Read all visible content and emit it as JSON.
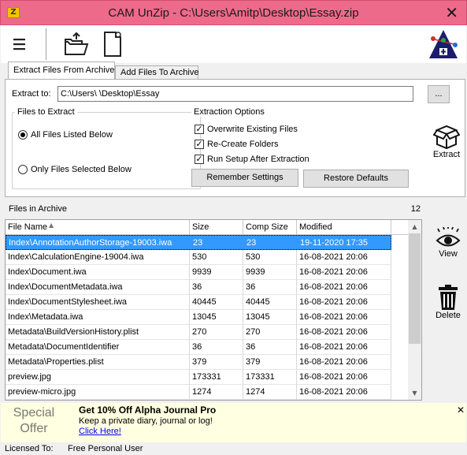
{
  "window": {
    "title": "CAM UnZip - C:\\Users\\Amitp\\Desktop\\Essay.zip",
    "close_glyph": "✕"
  },
  "toolbar": {
    "menu_icon": "hamburger-menu-icon",
    "extract_icon": "folder-extract-icon",
    "archive_icon": "document-archive-icon",
    "logo_icon": "cam-logo-icon"
  },
  "tabs": [
    {
      "label": "Extract Files From Archive",
      "active": true
    },
    {
      "label": "Add Files To Archive",
      "active": false
    }
  ],
  "extract": {
    "extract_to_label": "Extract to:",
    "extract_to_value": "C:\\Users\\      \\Desktop\\Essay",
    "browse_label": "...",
    "files_group_title": "Files to Extract",
    "radio_all": "All Files Listed Below",
    "radio_selected": "Only Files Selected Below",
    "options_group_title": "Extraction Options",
    "options": [
      {
        "label": "Overwrite Existing Files",
        "checked": true
      },
      {
        "label": "Re-Create Folders",
        "checked": true
      },
      {
        "label": "Run Setup After Extraction",
        "checked": true
      }
    ],
    "remember_label": "Remember Settings",
    "restore_label": "Restore Defaults",
    "extract_button_label": "Extract"
  },
  "files": {
    "header_label": "Files in Archive",
    "count": "12",
    "columns": [
      "File Name",
      "Size",
      "Comp Size",
      "Modified"
    ],
    "sort_glyph": "▲",
    "rows": [
      [
        "Index\\AnnotationAuthorStorage-19003.iwa",
        "23",
        "23",
        "19-11-2020 17:35"
      ],
      [
        "Index\\CalculationEngine-19004.iwa",
        "530",
        "530",
        "16-08-2021 20:06"
      ],
      [
        "Index\\Document.iwa",
        "9939",
        "9939",
        "16-08-2021 20:06"
      ],
      [
        "Index\\DocumentMetadata.iwa",
        "36",
        "36",
        "16-08-2021 20:06"
      ],
      [
        "Index\\DocumentStylesheet.iwa",
        "40445",
        "40445",
        "16-08-2021 20:06"
      ],
      [
        "Index\\Metadata.iwa",
        "13045",
        "13045",
        "16-08-2021 20:06"
      ],
      [
        "Metadata\\BuildVersionHistory.plist",
        "270",
        "270",
        "16-08-2021 20:06"
      ],
      [
        "Metadata\\DocumentIdentifier",
        "36",
        "36",
        "16-08-2021 20:06"
      ],
      [
        "Metadata\\Properties.plist",
        "379",
        "379",
        "16-08-2021 20:06"
      ],
      [
        "preview.jpg",
        "173331",
        "173331",
        "16-08-2021 20:06"
      ],
      [
        "preview-micro.jpg",
        "1274",
        "1274",
        "16-08-2021 20:06"
      ]
    ],
    "view_label": "View",
    "delete_label": "Delete"
  },
  "ad": {
    "special_line1": "Special",
    "special_line2": "Offer",
    "headline": "Get 10% Off Alpha Journal Pro",
    "subtitle": "Keep a private diary, journal or log!",
    "link": "Click Here!",
    "close_glyph": "✕"
  },
  "status": {
    "label": "Licensed To:",
    "value": "Free Personal User"
  },
  "colors": {
    "titlebar": "#ed6a8a",
    "selection": "#3399ff",
    "ad_bg": "#ffffe1",
    "link": "#0000ee"
  }
}
